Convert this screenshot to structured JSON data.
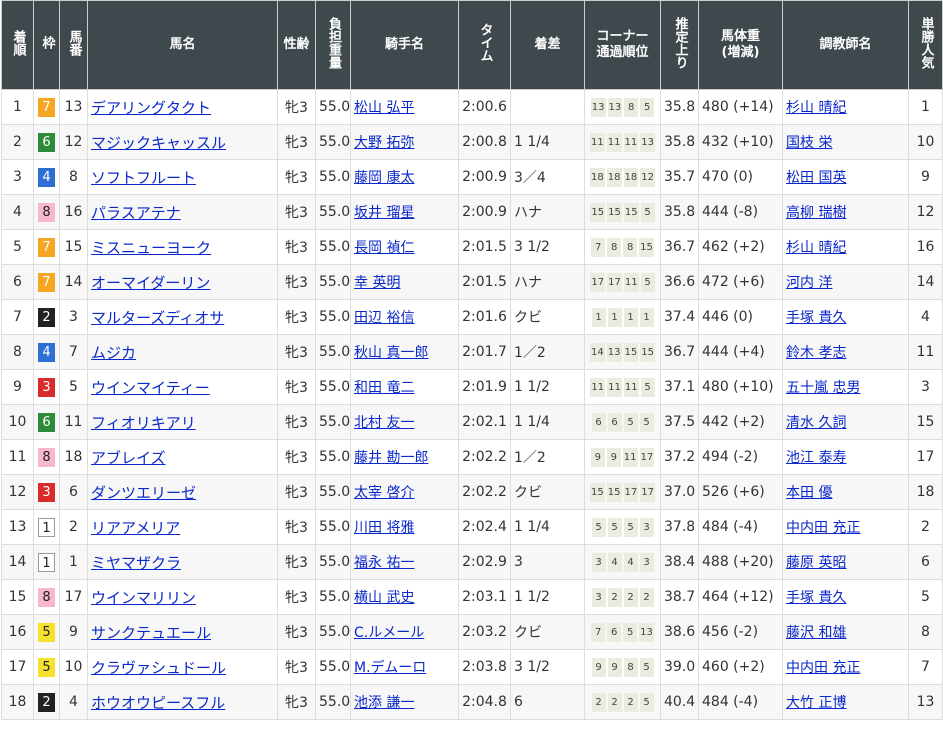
{
  "headers": {
    "rank": "着順",
    "waku": "枠",
    "umaban": "馬番",
    "horse": "馬名",
    "sexage": "性齢",
    "weight": "負担重量",
    "jockey": "騎手名",
    "time": "タイム",
    "margin": "着差",
    "corner_line1": "コーナー",
    "corner_line2": "通過順位",
    "agari": "推定上り",
    "body_line1": "馬体重",
    "body_line2": "(増減)",
    "trainer": "調教師名",
    "pop": "単勝人気"
  },
  "colors": {
    "header_bg": "#3f484d",
    "link": "#0b28c9",
    "waku_1": "#ffffff",
    "waku_2": "#222222",
    "waku_3": "#d92b2b",
    "waku_4": "#2e6fd3",
    "waku_5": "#f5e12e",
    "waku_6": "#2e8b3a",
    "waku_7": "#f5a623",
    "waku_8": "#f7b8c9"
  },
  "rows": [
    {
      "rank": "1",
      "waku": "7",
      "umaban": "13",
      "horse": "デアリングタクト",
      "sexage": "牝3",
      "weight": "55.0",
      "jockey": "松山 弘平",
      "time": "2:00.6",
      "margin": "",
      "corners": [
        "13",
        "13",
        "8",
        "5"
      ],
      "agari": "35.8",
      "body": "480 (+14)",
      "trainer": "杉山 晴紀",
      "pop": "1"
    },
    {
      "rank": "2",
      "waku": "6",
      "umaban": "12",
      "horse": "マジックキャッスル",
      "sexage": "牝3",
      "weight": "55.0",
      "jockey": "大野 拓弥",
      "time": "2:00.8",
      "margin": "1 1/4",
      "corners": [
        "11",
        "11",
        "11",
        "13"
      ],
      "agari": "35.8",
      "body": "432 (+10)",
      "trainer": "国枝 栄",
      "pop": "10"
    },
    {
      "rank": "3",
      "waku": "4",
      "umaban": "8",
      "horse": "ソフトフルート",
      "sexage": "牝3",
      "weight": "55.0",
      "jockey": "藤岡 康太",
      "time": "2:00.9",
      "margin": "3／4",
      "corners": [
        "18",
        "18",
        "18",
        "12"
      ],
      "agari": "35.7",
      "body": "470 (0)",
      "trainer": "松田 国英",
      "pop": "9"
    },
    {
      "rank": "4",
      "waku": "8",
      "umaban": "16",
      "horse": "パラスアテナ",
      "sexage": "牝3",
      "weight": "55.0",
      "jockey": "坂井 瑠星",
      "time": "2:00.9",
      "margin": "ハナ",
      "corners": [
        "15",
        "15",
        "15",
        "5"
      ],
      "agari": "35.8",
      "body": "444 (-8)",
      "trainer": "高柳 瑞樹",
      "pop": "12"
    },
    {
      "rank": "5",
      "waku": "7",
      "umaban": "15",
      "horse": "ミスニューヨーク",
      "sexage": "牝3",
      "weight": "55.0",
      "jockey": "長岡 禎仁",
      "time": "2:01.5",
      "margin": "3 1/2",
      "corners": [
        "7",
        "8",
        "8",
        "15"
      ],
      "agari": "36.7",
      "body": "462 (+2)",
      "trainer": "杉山 晴紀",
      "pop": "16"
    },
    {
      "rank": "6",
      "waku": "7",
      "umaban": "14",
      "horse": "オーマイダーリン",
      "sexage": "牝3",
      "weight": "55.0",
      "jockey": "幸 英明",
      "time": "2:01.5",
      "margin": "ハナ",
      "corners": [
        "17",
        "17",
        "11",
        "5"
      ],
      "agari": "36.6",
      "body": "472 (+6)",
      "trainer": "河内 洋",
      "pop": "14"
    },
    {
      "rank": "7",
      "waku": "2",
      "umaban": "3",
      "horse": "マルターズディオサ",
      "sexage": "牝3",
      "weight": "55.0",
      "jockey": "田辺 裕信",
      "time": "2:01.6",
      "margin": "クビ",
      "corners": [
        "1",
        "1",
        "1",
        "1"
      ],
      "agari": "37.4",
      "body": "446 (0)",
      "trainer": "手塚 貴久",
      "pop": "4"
    },
    {
      "rank": "8",
      "waku": "4",
      "umaban": "7",
      "horse": "ムジカ",
      "sexage": "牝3",
      "weight": "55.0",
      "jockey": "秋山 真一郎",
      "time": "2:01.7",
      "margin": "1／2",
      "corners": [
        "14",
        "13",
        "15",
        "15"
      ],
      "agari": "36.7",
      "body": "444 (+4)",
      "trainer": "鈴木 孝志",
      "pop": "11"
    },
    {
      "rank": "9",
      "waku": "3",
      "umaban": "5",
      "horse": "ウインマイティー",
      "sexage": "牝3",
      "weight": "55.0",
      "jockey": "和田 竜二",
      "time": "2:01.9",
      "margin": "1 1/2",
      "corners": [
        "11",
        "11",
        "11",
        "5"
      ],
      "agari": "37.1",
      "body": "480 (+10)",
      "trainer": "五十嵐 忠男",
      "pop": "3"
    },
    {
      "rank": "10",
      "waku": "6",
      "umaban": "11",
      "horse": "フィオリキアリ",
      "sexage": "牝3",
      "weight": "55.0",
      "jockey": "北村 友一",
      "time": "2:02.1",
      "margin": "1 1/4",
      "corners": [
        "6",
        "6",
        "5",
        "5"
      ],
      "agari": "37.5",
      "body": "442 (+2)",
      "trainer": "清水 久詞",
      "pop": "15"
    },
    {
      "rank": "11",
      "waku": "8",
      "umaban": "18",
      "horse": "アブレイズ",
      "sexage": "牝3",
      "weight": "55.0",
      "jockey": "藤井 勘一郎",
      "time": "2:02.2",
      "margin": "1／2",
      "corners": [
        "9",
        "9",
        "11",
        "17"
      ],
      "agari": "37.2",
      "body": "494 (-2)",
      "trainer": "池江 泰寿",
      "pop": "17"
    },
    {
      "rank": "12",
      "waku": "3",
      "umaban": "6",
      "horse": "ダンツエリーゼ",
      "sexage": "牝3",
      "weight": "55.0",
      "jockey": "太宰 啓介",
      "time": "2:02.2",
      "margin": "クビ",
      "corners": [
        "15",
        "15",
        "17",
        "17"
      ],
      "agari": "37.0",
      "body": "526 (+6)",
      "trainer": "本田 優",
      "pop": "18"
    },
    {
      "rank": "13",
      "waku": "1",
      "umaban": "2",
      "horse": "リアアメリア",
      "sexage": "牝3",
      "weight": "55.0",
      "jockey": "川田 将雅",
      "time": "2:02.4",
      "margin": "1 1/4",
      "corners": [
        "5",
        "5",
        "5",
        "3"
      ],
      "agari": "37.8",
      "body": "484 (-4)",
      "trainer": "中内田 充正",
      "pop": "2"
    },
    {
      "rank": "14",
      "waku": "1",
      "umaban": "1",
      "horse": "ミヤマザクラ",
      "sexage": "牝3",
      "weight": "55.0",
      "jockey": "福永 祐一",
      "time": "2:02.9",
      "margin": "3",
      "corners": [
        "3",
        "4",
        "4",
        "3"
      ],
      "agari": "38.4",
      "body": "488 (+20)",
      "trainer": "藤原 英昭",
      "pop": "6"
    },
    {
      "rank": "15",
      "waku": "8",
      "umaban": "17",
      "horse": "ウインマリリン",
      "sexage": "牝3",
      "weight": "55.0",
      "jockey": "横山 武史",
      "time": "2:03.1",
      "margin": "1 1/2",
      "corners": [
        "3",
        "2",
        "2",
        "2"
      ],
      "agari": "38.7",
      "body": "464 (+12)",
      "trainer": "手塚 貴久",
      "pop": "5"
    },
    {
      "rank": "16",
      "waku": "5",
      "umaban": "9",
      "horse": "サンクテュエール",
      "sexage": "牝3",
      "weight": "55.0",
      "jockey": "C.ルメール",
      "time": "2:03.2",
      "margin": "クビ",
      "corners": [
        "7",
        "6",
        "5",
        "13"
      ],
      "agari": "38.6",
      "body": "456 (-2)",
      "trainer": "藤沢 和雄",
      "pop": "8"
    },
    {
      "rank": "17",
      "waku": "5",
      "umaban": "10",
      "horse": "クラヴァシュドール",
      "sexage": "牝3",
      "weight": "55.0",
      "jockey": "M.デムーロ",
      "time": "2:03.8",
      "margin": "3 1/2",
      "corners": [
        "9",
        "9",
        "8",
        "5"
      ],
      "agari": "39.0",
      "body": "460 (+2)",
      "trainer": "中内田 充正",
      "pop": "7"
    },
    {
      "rank": "18",
      "waku": "2",
      "umaban": "4",
      "horse": "ホウオウピースフル",
      "sexage": "牝3",
      "weight": "55.0",
      "jockey": "池添 謙一",
      "time": "2:04.8",
      "margin": "6",
      "corners": [
        "2",
        "2",
        "2",
        "5"
      ],
      "agari": "40.4",
      "body": "484 (-4)",
      "trainer": "大竹 正博",
      "pop": "13"
    }
  ]
}
